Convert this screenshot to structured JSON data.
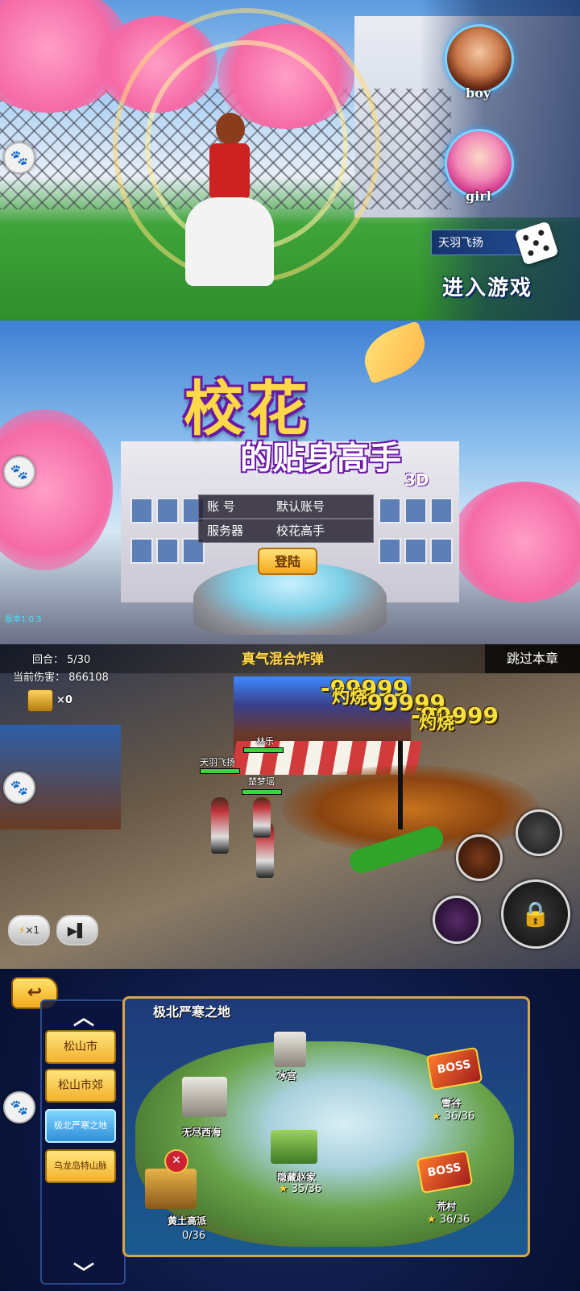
{
  "panel1": {
    "boy_label": "boy",
    "girl_label": "girl",
    "name_value": "天羽飞扬",
    "enter_label": "进入游戏"
  },
  "panel2": {
    "title_main": "校花",
    "title_sub": "的贴身高手",
    "title_3d": "3D",
    "account_label": "账    号",
    "account_value": "默认账号",
    "server_label": "服务器",
    "server_value": "校花高手",
    "login_label": "登陆",
    "version": "版本1.0.3"
  },
  "panel3": {
    "skill_name": "真气混合炸弹",
    "skip_label": "跳过本章",
    "round_text": "回合：  5/30",
    "damage_text": "当前伤害：  866108",
    "chest_count": "×0",
    "damage_numbers": [
      "-99999",
      "-99999",
      "-99999"
    ],
    "burn_labels": [
      "灼烧",
      "灼烧"
    ],
    "hero_names": [
      "天羽飞扬",
      "林乐",
      "楚梦瑶"
    ],
    "speed_label": "×1"
  },
  "panel4": {
    "back_icon": "↩",
    "map_title": "极北严寒之地",
    "regions": [
      "松山市",
      "松山市郊",
      "极北严寒之地",
      "乌龙岛特山脉"
    ],
    "locations": {
      "ice_palace": "冰宫",
      "endless_sea": "无尽西海",
      "snow_valley": "雪谷",
      "hidden_zhao": "隐藏赵家",
      "wasteland": "荒村",
      "huangtu": "黄土高派"
    },
    "boss_small": "BOSS",
    "stars": {
      "snow_valley": "36/36",
      "hidden_zhao": "35/36",
      "wasteland": "36/36",
      "huangtu": "0/36"
    }
  },
  "icons": [
    "du-paw-icon",
    "dice-icon",
    "chevron-up-icon",
    "chevron-down-icon",
    "star-icon",
    "lock-icon",
    "play-pause-icon",
    "lightning-icon"
  ]
}
